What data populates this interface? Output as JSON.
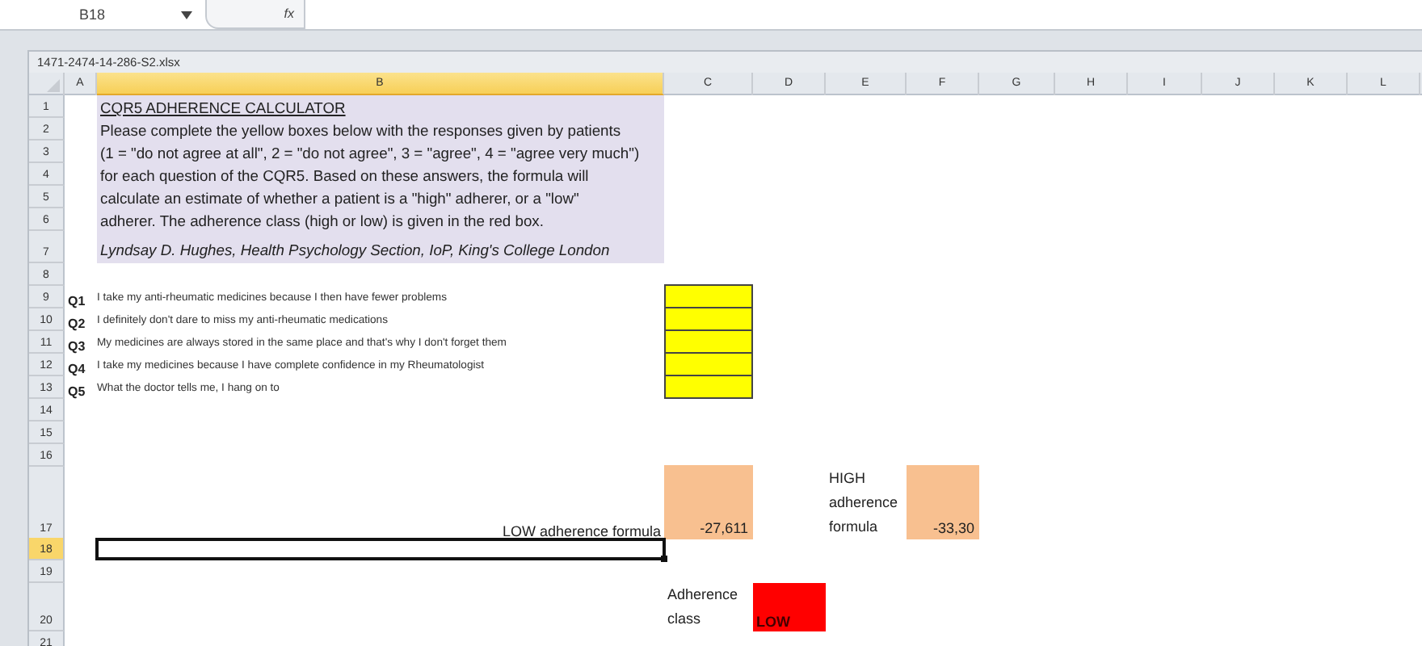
{
  "formula_bar": {
    "name_box": "B18",
    "fx_label": "fx"
  },
  "workbook": {
    "title": "1471-2474-14-286-S2.xlsx"
  },
  "columns": [
    {
      "label": "A",
      "selected": false
    },
    {
      "label": "B",
      "selected": true
    },
    {
      "label": "C",
      "selected": false
    },
    {
      "label": "D",
      "selected": false
    },
    {
      "label": "E",
      "selected": false
    },
    {
      "label": "F",
      "selected": false
    },
    {
      "label": "G",
      "selected": false
    },
    {
      "label": "H",
      "selected": false
    },
    {
      "label": "I",
      "selected": false
    },
    {
      "label": "J",
      "selected": false
    },
    {
      "label": "K",
      "selected": false
    },
    {
      "label": "L",
      "selected": false
    }
  ],
  "rows": [
    {
      "number": "1",
      "selected": false,
      "kind": "info-title",
      "text": "CQR5 ADHERENCE CALCULATOR"
    },
    {
      "number": "2",
      "selected": false,
      "kind": "info",
      "text": "Please complete the yellow boxes below with the responses given by patients"
    },
    {
      "number": "3",
      "selected": false,
      "kind": "info",
      "text": "(1 = \"do not agree at all\", 2 = \"do not agree\", 3 = \"agree\", 4 = \"agree very much\")"
    },
    {
      "number": "4",
      "selected": false,
      "kind": "info",
      "text": "for each question of the CQR5. Based on these answers, the formula will"
    },
    {
      "number": "5",
      "selected": false,
      "kind": "info",
      "text": "calculate an estimate of whether a patient is a \"high\" adherer, or a \"low\""
    },
    {
      "number": "6",
      "selected": false,
      "kind": "info",
      "text": "adherer. The adherence class (high or low) is given in the red box."
    },
    {
      "number": "7",
      "selected": false,
      "kind": "info-credit",
      "text": "Lyndsay D. Hughes, Health Psychology Section, IoP, King's College London"
    },
    {
      "number": "8",
      "selected": false,
      "kind": "blank"
    },
    {
      "number": "9",
      "selected": false,
      "kind": "question",
      "id": "Q1",
      "text": "I take my anti-rheumatic medicines because I then have fewer problems"
    },
    {
      "number": "10",
      "selected": false,
      "kind": "question",
      "id": "Q2",
      "text": "I definitely don't dare to miss my anti-rheumatic medications"
    },
    {
      "number": "11",
      "selected": false,
      "kind": "question",
      "id": "Q3",
      "text": "My medicines are always stored in the same place and that's why I don't forget them"
    },
    {
      "number": "12",
      "selected": false,
      "kind": "question",
      "id": "Q4",
      "text": "I take my medicines because I have complete confidence in my Rheumatologist"
    },
    {
      "number": "13",
      "selected": false,
      "kind": "question",
      "id": "Q5",
      "text": "What the doctor tells me, I hang on to"
    },
    {
      "number": "14",
      "selected": false,
      "kind": "blank"
    },
    {
      "number": "15",
      "selected": false,
      "kind": "blank"
    },
    {
      "number": "16",
      "selected": false,
      "kind": "blank"
    },
    {
      "number": "17",
      "selected": false,
      "kind": "formulas",
      "low_label": "LOW adherence formula",
      "low_value": "-27,611",
      "high_label": "HIGH adherence formula",
      "high_value": "-33,30"
    },
    {
      "number": "18",
      "selected": true,
      "kind": "blank"
    },
    {
      "number": "19",
      "selected": false,
      "kind": "blank"
    },
    {
      "number": "20",
      "selected": false,
      "kind": "class",
      "label": "Adherence class",
      "value": "LOW"
    },
    {
      "number": "21",
      "selected": false,
      "kind": "blank"
    }
  ]
}
